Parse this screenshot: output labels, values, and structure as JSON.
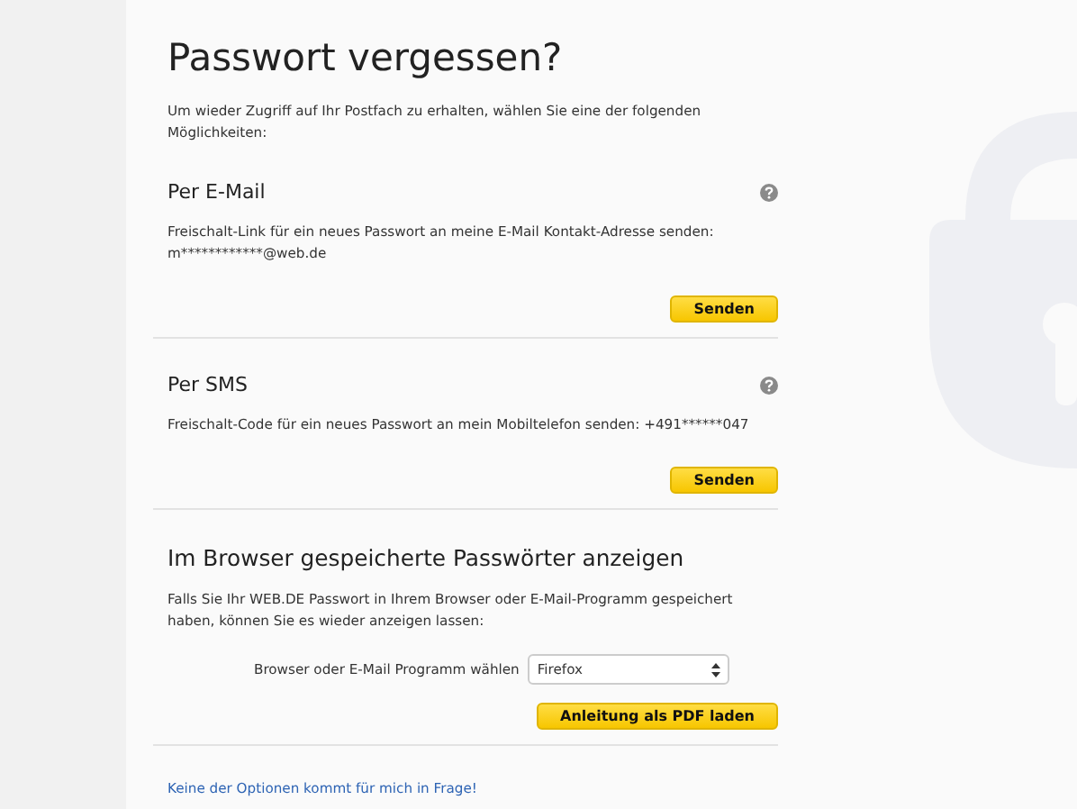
{
  "title": "Passwort vergessen?",
  "intro": "Um wieder Zugriff auf Ihr Postfach zu erhalten, wählen Sie eine der folgenden Möglichkeiten:",
  "sections": [
    {
      "kind": "send",
      "heading": "Per E-Mail",
      "text": "Freischalt-Link für ein neues Passwort an meine E-Mail Kontakt-Adresse senden: m************@web.de",
      "button": "Senden"
    },
    {
      "kind": "send",
      "heading": "Per SMS",
      "text": "Freischalt-Code für ein neues Passwort an mein Mobiltelefon senden: +491******047",
      "button": "Senden"
    },
    {
      "kind": "browser",
      "heading": "Im Browser gespeicherte Passwörter anzeigen",
      "text": "Falls Sie Ihr WEB.DE Passwort in Ihrem Browser oder E-Mail-Programm gespeichert haben, können Sie es wieder anzeigen lassen:",
      "select_label": "Browser oder E-Mail Programm wählen",
      "select_value": "Firefox",
      "button": "Anleitung als PDF laden"
    }
  ],
  "footer_link": "Keine der Optionen kommt für mich in Frage!"
}
